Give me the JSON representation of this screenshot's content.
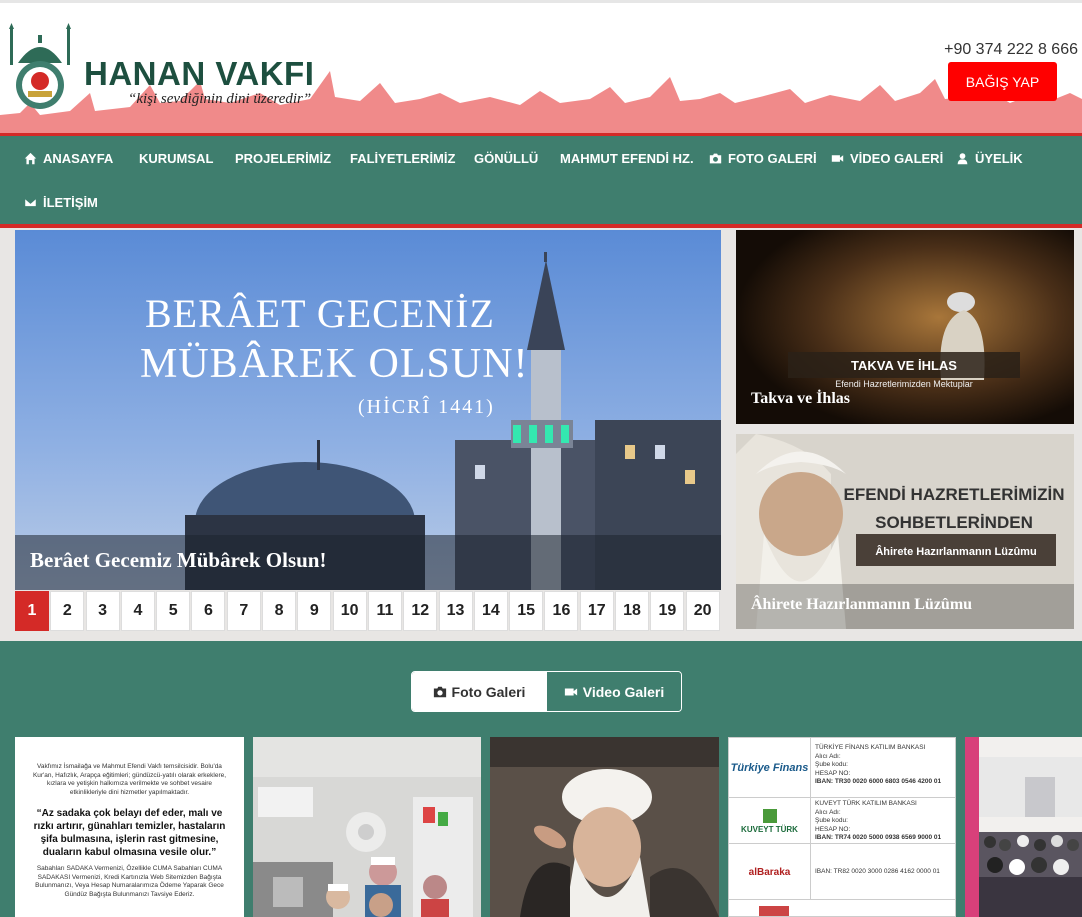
{
  "header": {
    "brand": "HANAN VAKFI",
    "tagline": "“kişi sevdiğinin dini üzeredir”",
    "phone": "+90 374 222 8 666",
    "donate_label": "BAĞIŞ YAP"
  },
  "nav": {
    "items": [
      {
        "label": "ANASAYFA",
        "icon": "home-icon"
      },
      {
        "label": "KURUMSAL"
      },
      {
        "label": "PROJELERİMİZ"
      },
      {
        "label": "FALİYETLERİMİZ"
      },
      {
        "label": "GÖNÜLLÜ"
      },
      {
        "label": "MAHMUT EFENDİ HZ."
      },
      {
        "label": "FOTO GALERİ",
        "icon": "camera-icon"
      },
      {
        "label": "VİDEO GALERİ",
        "icon": "video-icon"
      },
      {
        "label": "ÜYELİK",
        "icon": "user-icon"
      },
      {
        "label": "İLETİŞİM",
        "icon": "envelope-icon"
      }
    ]
  },
  "slider": {
    "image_text_1": "BERÂET GECENİZ",
    "image_text_2": "MÜBÂREK OLSUN!",
    "image_text_3": "(HİCRÎ 1441)",
    "caption": "Berâet Gecemiz Mübârek Olsun!",
    "pages": [
      "1",
      "2",
      "3",
      "4",
      "5",
      "6",
      "7",
      "8",
      "9",
      "10",
      "11",
      "12",
      "13",
      "14",
      "15",
      "16",
      "17",
      "18",
      "19",
      "20"
    ],
    "active_page": "1"
  },
  "side_cards": [
    {
      "image_title": "TAKVA VE İHLAS",
      "image_subtitle": "Efendi Hazretlerimizden Mektuplar",
      "caption": "Takva ve İhlas"
    },
    {
      "image_title_1": "EFENDİ HAZRETLERİMİZİN",
      "image_title_2": "SOHBETLERİNDEN",
      "image_subtitle": "Âhirete Hazırlanmanın Lüzûmu",
      "caption": "Âhirete Hazırlanmanın Lüzûmu"
    }
  ],
  "gallery": {
    "tabs": [
      {
        "label": "Foto Galeri",
        "icon": "camera-icon",
        "active": true
      },
      {
        "label": "Video Galeri",
        "icon": "video-icon",
        "active": false
      }
    ],
    "doc_text": {
      "para1": "Vakfımız İsmailağa ve Mahmut Efendi Vakfı temsilcisidir. Bolu'da Kur'an, Hafızlık, Arapça eğitimleri; gündüzcü-yatılı olarak erkeklere, kızlara ve yetişkin halkımıza verilmekte ve sohbet vesaire etkinlikleriyle dini hizmetler yapılmaktadır.",
      "quote": "“Az sadaka çok belayı def eder, malı ve rızkı artırır, günahları temizler, hastaların şifa bulmasına, işlerin rast gitmesine, duaların kabul olmasına vesile olur.”",
      "para2": "Sabahları SADAKA Vermenizi, Özellikle CUMA Sabahları CUMA SADAKASI Vermenizi, Kredi Kartınızla Web Sitemizden Bağışta Bulunmanızı, Veya Hesap Numaralarımıza Ödeme Yaparak Gece Gündüz Bağışta Bulunmanızı Tavsiye Ederiz."
    },
    "banks": [
      {
        "logo": "Türkiye Finans",
        "name": "TÜRKİYE FİNANS KATILIM BANKASI",
        "line1": "Alıcı Adı:",
        "line2": "Şube kodu:",
        "line3": "HESAP NO:",
        "iban": "IBAN: TR30 0020 6000 6803 0546 4200 01"
      },
      {
        "logo": "KUVEYT TÜRK",
        "name": "KUVEYT TÜRK KATILIM BANKASI",
        "line1": "Alıcı Adı:",
        "line2": "Şube kodu:",
        "line3": "HESAP NO:",
        "iban": "IBAN: TR74 0020 5000 0938 6569 9000 01"
      },
      {
        "logo": "alBaraka",
        "iban": "IBAN: TR82 0020 3000 0286 4162 0000 01"
      }
    ]
  },
  "colors": {
    "primary_green": "#3f7e6e",
    "accent_red": "#d42a27",
    "brand_dark": "#1d4f3f",
    "skyline_pink": "#f08a8a",
    "donate_red": "#ff0000"
  }
}
